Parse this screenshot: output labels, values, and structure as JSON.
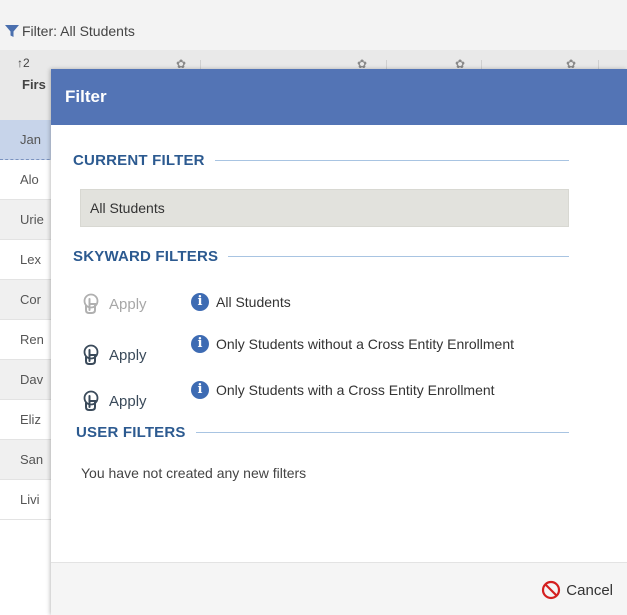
{
  "toolbar": {
    "filter_label": "Filter: All Students"
  },
  "grid": {
    "sort_indicator": "↑2",
    "first_column_label": "Firs",
    "rows": [
      "Jan",
      "Alo",
      "Urie",
      "Lex",
      "Cor",
      "Ren",
      "Dav",
      "Eliz",
      "San",
      "Livi"
    ]
  },
  "dialog": {
    "title": "Filter",
    "current_filter": {
      "heading": "CURRENT FILTER",
      "value": "All Students"
    },
    "skyward_filters": {
      "heading": "SKYWARD FILTERS",
      "items": [
        {
          "apply_label": "Apply",
          "description": "All Students",
          "disabled": true
        },
        {
          "apply_label": "Apply",
          "description": "Only Students without a Cross Entity Enrollment",
          "disabled": false
        },
        {
          "apply_label": "Apply",
          "description": "Only Students with a Cross Entity Enrollment",
          "disabled": false
        }
      ]
    },
    "user_filters": {
      "heading": "USER FILTERS",
      "empty_message": "You have not created any new filters"
    },
    "footer": {
      "cancel_label": "Cancel"
    }
  },
  "colors": {
    "header_blue": "#5374b5",
    "section_title": "#2c5a90",
    "info_icon": "#3d6bb3",
    "cancel_icon": "#d42020"
  },
  "icons": {
    "filter": "funnel-icon",
    "apply": "hand-pointer-icon",
    "info": "info-icon",
    "cancel": "no-entry-icon",
    "column_settings": "gear-icon"
  }
}
